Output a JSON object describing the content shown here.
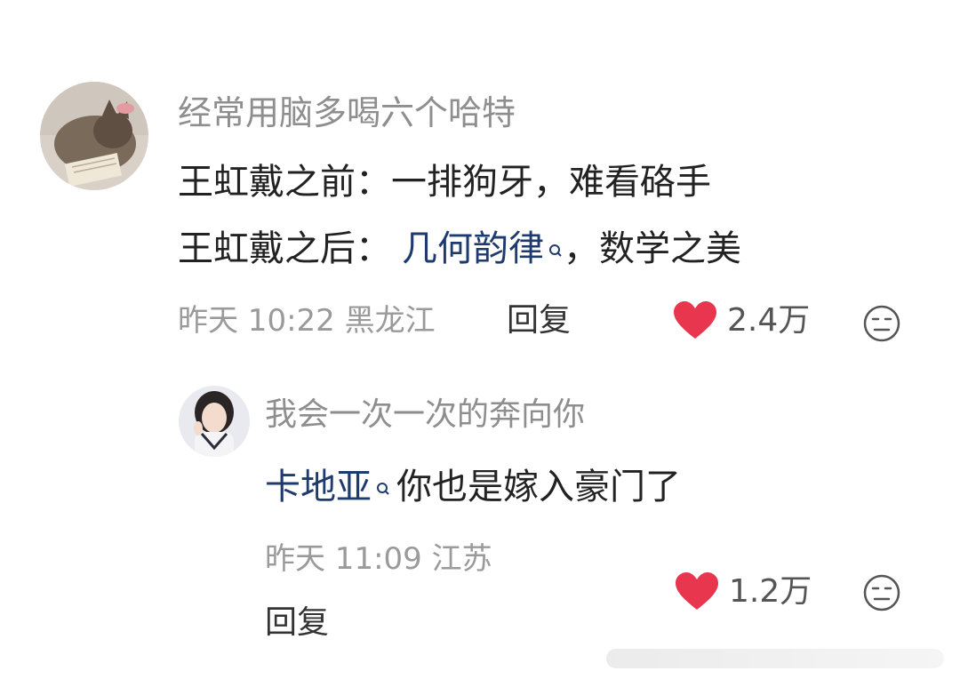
{
  "comment": {
    "username": "经常用脑多喝六个哈特",
    "line1": "王虹戴之前：一排狗牙，难看硌手",
    "line2_prefix": "王虹戴之后：",
    "line2_link": "几何韵律",
    "line2_suffix": "，数学之美",
    "time": "昨天 10:22",
    "location": "黑龙江",
    "reply_label": "回复",
    "likes": "2.4万"
  },
  "reply": {
    "username": "我会一次一次的奔向你",
    "link": "卡地亚",
    "text": "你也是嫁入豪门了",
    "time": "昨天 11:09",
    "location": "江苏",
    "reply_label": "回复",
    "likes": "1.2万"
  },
  "icons": {
    "like": "heart-icon",
    "dislike": "neutral-face-icon",
    "search": "search-icon"
  },
  "colors": {
    "heart": "#e8364e",
    "link": "#1f3a6e"
  }
}
